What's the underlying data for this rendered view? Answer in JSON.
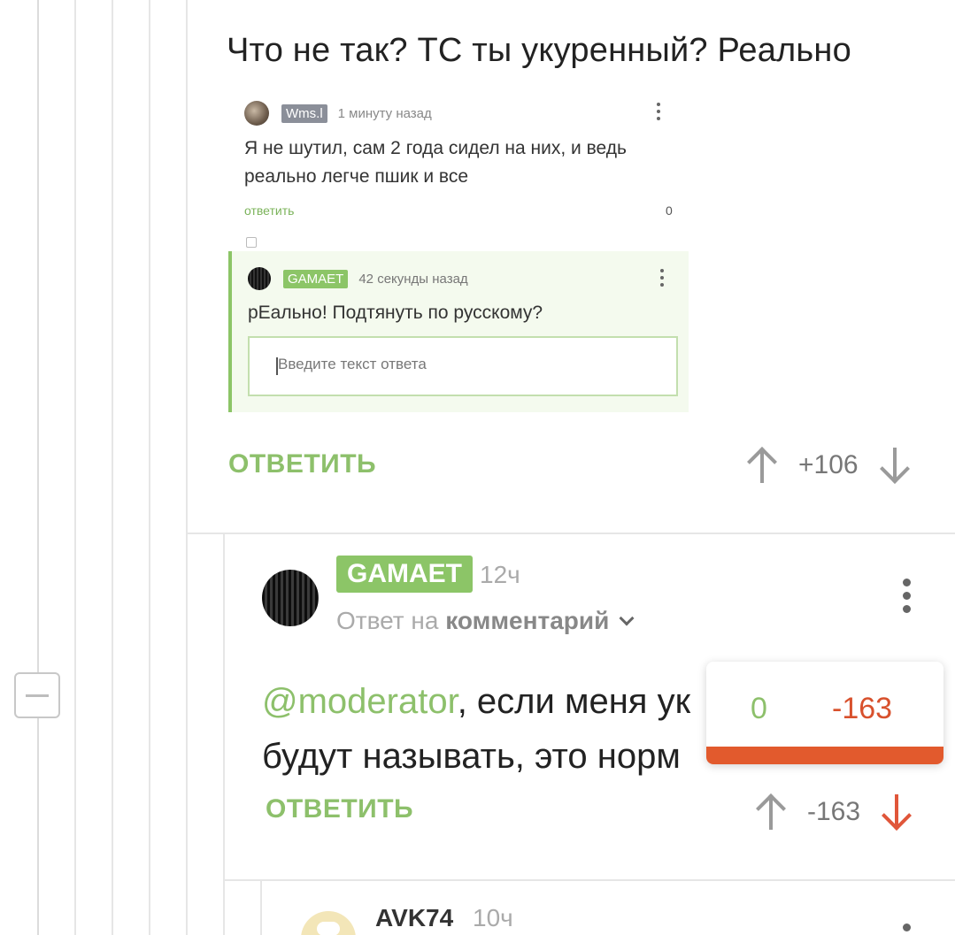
{
  "comment1": {
    "text": "Что не так? ТС ты укуренный? Реально",
    "screenshot": {
      "comment_a": {
        "author": "Wms.l",
        "time": "1 минуту назад",
        "text": "Я не шутил, сам 2 года сидел на них, и ведь реально легче пшик и все",
        "reply_label": "ответить",
        "score": "0"
      },
      "comment_b": {
        "author": "GAMAET",
        "time": "42 секунды назад",
        "text": "рЕально! Подтянуть по русскому?",
        "input_placeholder": "Введите текст ответа"
      }
    },
    "reply_label": "ОТВЕТИТЬ",
    "score": "+106"
  },
  "comment2": {
    "author": "GAMAET",
    "time": "12ч",
    "reply_to_prefix": "Ответ на",
    "reply_to_target": "комментарий",
    "mention": "@moderator",
    "text_rest_line1": ", если меня ук",
    "text_line2": "будут называть, это норм",
    "reply_label": "ОТВЕТИТЬ",
    "score": "-163",
    "rating_popup": {
      "pluses": "0",
      "minuses": "-163"
    }
  },
  "comment3": {
    "author": "AVK74",
    "time": "10ч"
  },
  "colors": {
    "accent_green": "#8dc06b",
    "negative_red": "#e25a2d",
    "badge_green": "#8cc567"
  },
  "icons": [
    "collapse-icon",
    "upvote-icon",
    "downvote-icon",
    "more-options-icon",
    "chevron-down-icon"
  ]
}
